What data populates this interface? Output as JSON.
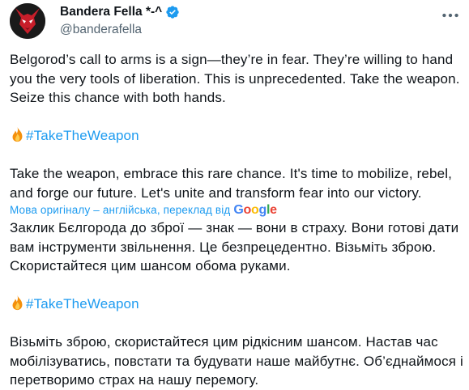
{
  "author": {
    "display_name": "Bandera Fella *-^",
    "handle": "@banderafella",
    "verified": true
  },
  "tweet": {
    "original_text": "Belgorod’s call to arms is a sign—they’re in fear. They’re willing to hand you the very tools of liberation. This is unprecedented. Take the weapon. Seize this chance with both hands.",
    "hashtag_1": "#TakeTheWeapon",
    "original_text_2": "Take the weapon, embrace this rare chance. It's time to mobilize, rebel, and forge our future. Let's unite and transform fear into our victory."
  },
  "translation": {
    "notice": "Мова оригіналу – англійська, переклад від",
    "provider_logo": [
      "G",
      "o",
      "o",
      "g",
      "l",
      "e"
    ],
    "translated_text": "Заклик Бєлгорода до зброї — знак — вони в страху. Вони готові дати вам інструменти звільнення. Це безпрецедентно. Візьміть зброю. Скористайтеся цим шансом обома руками.",
    "hashtag_2": "#TakeTheWeapon",
    "translated_text_2": "Візьміть зброю, скористайтеся цим рідкісним шансом. Настав час мобілізуватись, повстати та будувати наше майбутнє. Об’єднаймося і перетворимо страх на нашу перемогу."
  },
  "icons": {
    "avatar": "red-horned-mask-avatar",
    "verified": "verified-badge-icon",
    "more": "more-options-icon",
    "hashtag_emoji": "fire-icon"
  },
  "colors": {
    "text": "#0f1419",
    "secondary": "#536471",
    "link": "#1d9bf0",
    "verified": "#1d9bf0",
    "fire_outer": "#f4900c",
    "fire_inner": "#ffcc4d",
    "avatar_bg": "#1a1a1a",
    "avatar_red": "#c81e2a"
  }
}
